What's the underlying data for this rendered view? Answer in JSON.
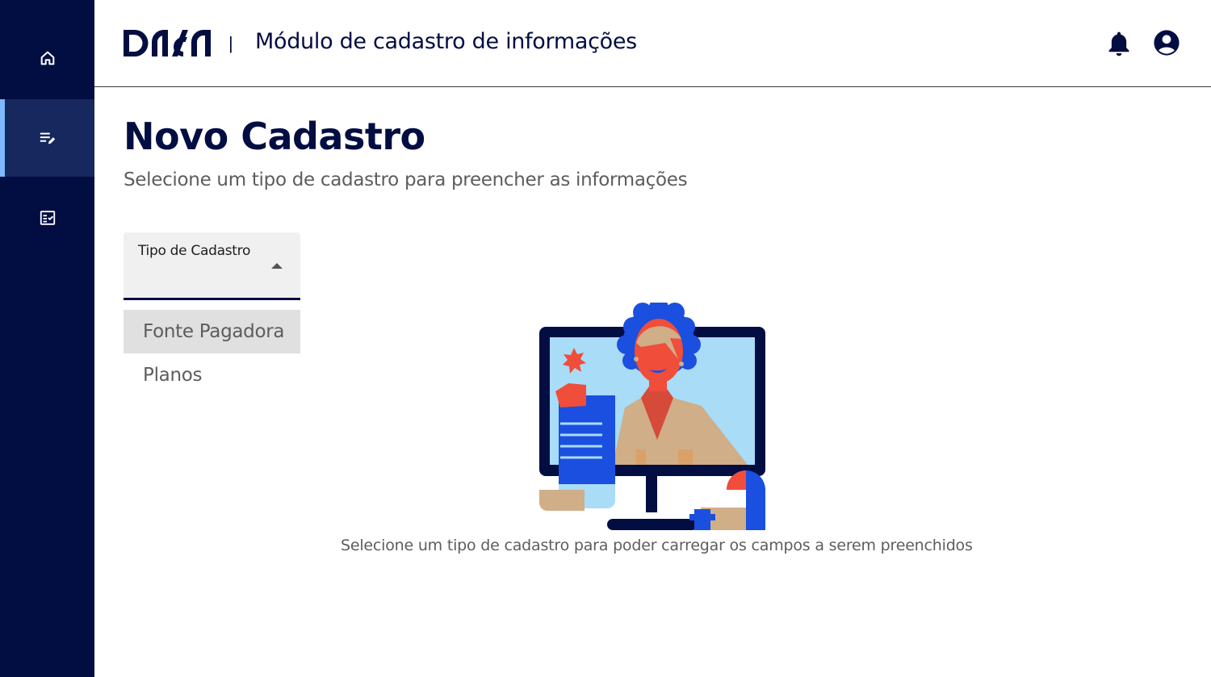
{
  "sidebar": {
    "items": [
      {
        "icon": "home-icon",
        "active": false
      },
      {
        "icon": "edit-list-icon",
        "active": true
      },
      {
        "icon": "checklist-icon",
        "active": false
      }
    ]
  },
  "header": {
    "brand": "dasa",
    "separator": "|",
    "title": "Módulo de cadastro de informações",
    "icons": [
      "bell-icon",
      "user-account-icon"
    ]
  },
  "main": {
    "title": "Novo Cadastro",
    "subtitle": "Selecione um tipo de cadastro para preencher as informações",
    "select": {
      "label": "Tipo de Cadastro",
      "value": "",
      "open": true,
      "options": [
        "Fonte Pagadora",
        "Planos"
      ]
    },
    "empty_state": {
      "message": "Selecione um tipo de cadastro para poder carregar os campos a serem preenchidos"
    }
  },
  "colors": {
    "navy": "#020d42",
    "sidebar_active": "#16285e",
    "accent": "#7fb8ff",
    "text_muted": "#5d5d5d",
    "select_bg": "#f0f0f0"
  }
}
